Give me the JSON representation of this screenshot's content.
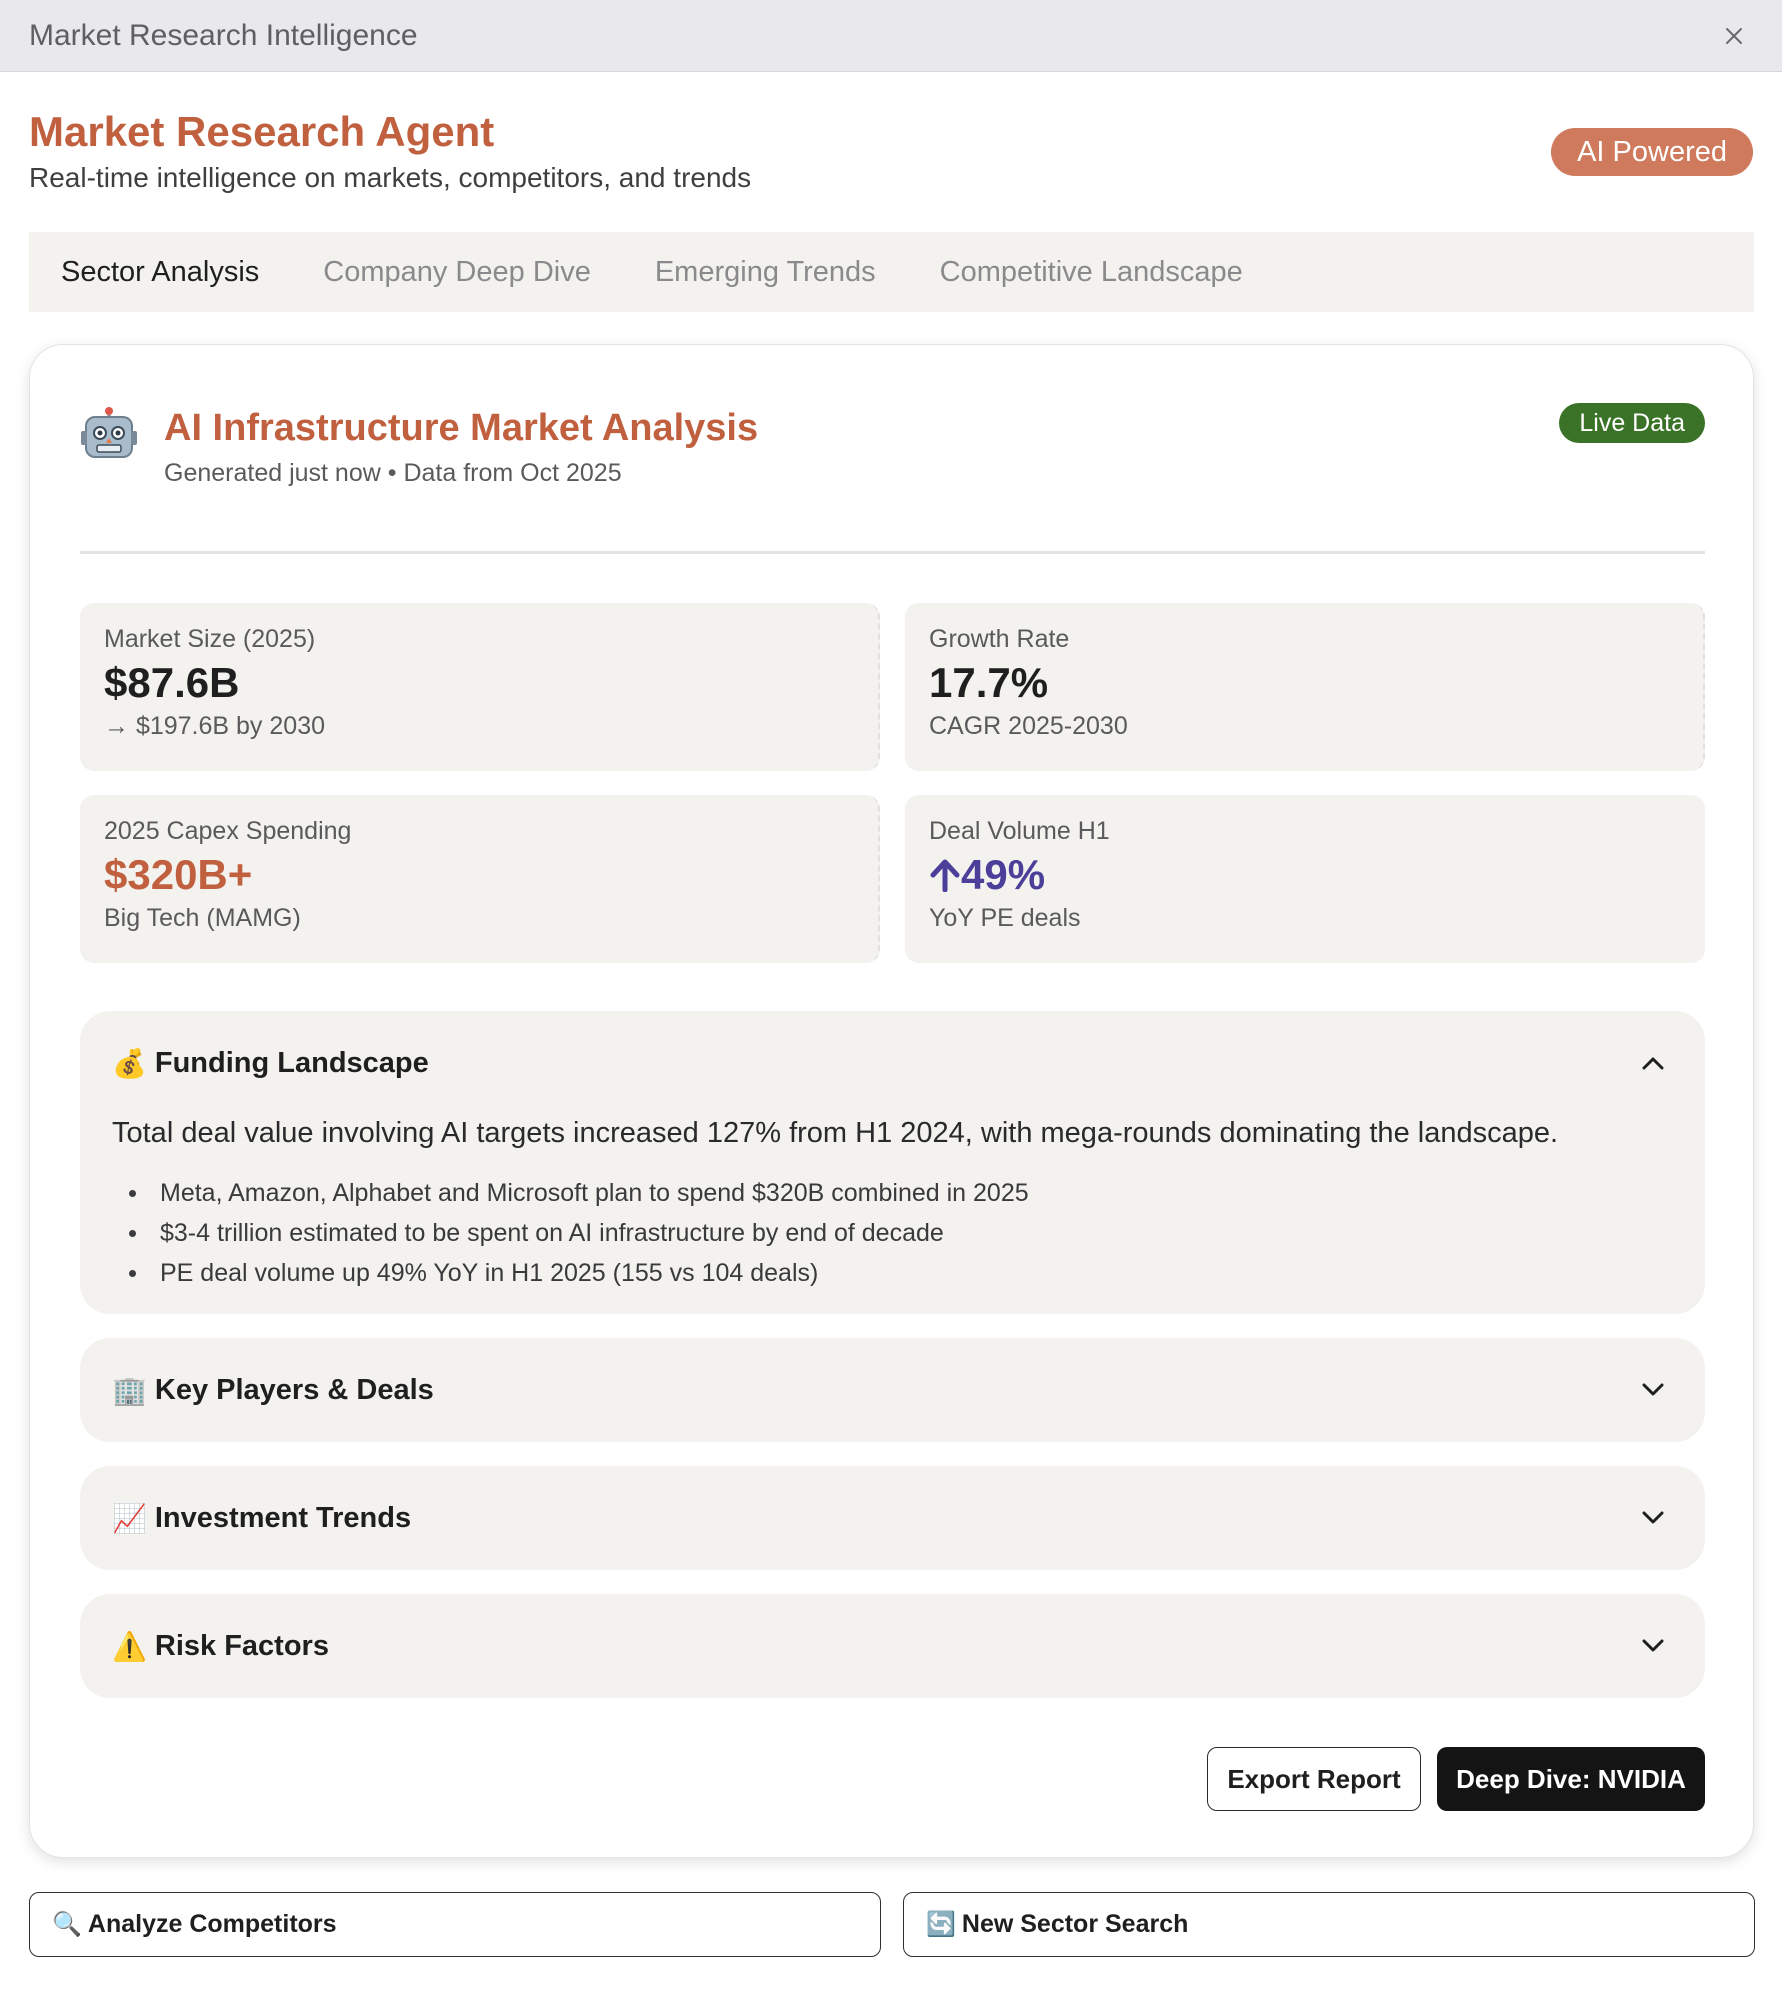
{
  "window": {
    "title": "Market Research Intelligence"
  },
  "header": {
    "title": "Market Research Agent",
    "subtitle": "Real-time intelligence on markets, competitors, and trends",
    "badge": "AI Powered"
  },
  "tabs": [
    {
      "label": "Sector Analysis",
      "active": true
    },
    {
      "label": "Company Deep Dive",
      "active": false
    },
    {
      "label": "Emerging Trends",
      "active": false
    },
    {
      "label": "Competitive Landscape",
      "active": false
    }
  ],
  "report": {
    "title": "AI Infrastructure Market Analysis",
    "meta": "Generated just now • Data from Oct 2025",
    "badge": "Live Data",
    "icon": "robot-icon"
  },
  "metrics": [
    {
      "label": "Market Size (2025)",
      "value": "$87.6B",
      "sub": "→ $197.6B by 2030"
    },
    {
      "label": "Growth Rate",
      "value": "17.7%",
      "sub": "CAGR 2025-2030"
    },
    {
      "label": "2025 Capex Spending",
      "value": "$320B+",
      "sub": "Big Tech (MAMG)"
    },
    {
      "label": "Deal Volume H1",
      "value": "49%",
      "sub": "YoY PE deals"
    }
  ],
  "sections": [
    {
      "emoji": "💰",
      "title": "Funding Landscape",
      "expanded": true,
      "summary": "Total deal value involving AI targets increased 127% from H1 2024, with mega-rounds dominating the landscape.",
      "bullets": [
        "Meta, Amazon, Alphabet and Microsoft plan to spend $320B combined in 2025",
        "$3-4 trillion estimated to be spent on AI infrastructure by end of decade",
        "PE deal volume up 49% YoY in H1 2025 (155 vs 104 deals)"
      ]
    },
    {
      "emoji": "🏢",
      "title": "Key Players & Deals",
      "expanded": false
    },
    {
      "emoji": "📈",
      "title": "Investment Trends",
      "expanded": false
    },
    {
      "emoji": "⚠️",
      "title": "Risk Factors",
      "expanded": false
    }
  ],
  "actions": {
    "export": "Export Report",
    "deep_dive": "Deep Dive: NVIDIA"
  },
  "bottom": [
    {
      "emoji": "🔍",
      "label": "Analyze Competitors"
    },
    {
      "emoji": "🔄",
      "label": "New Sector Search"
    }
  ],
  "colors": {
    "accent": "#c0603f",
    "badge": "#cf7a5c",
    "live": "#3a7227",
    "purple": "#4b3f9a"
  }
}
